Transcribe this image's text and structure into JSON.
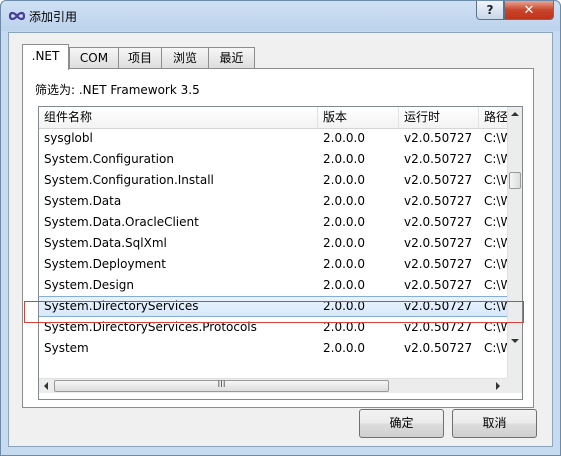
{
  "window": {
    "title": "添加引用",
    "help_glyph": "?",
    "close_glyph": "✕"
  },
  "tabs": [
    {
      "label": ".NET",
      "active": true
    },
    {
      "label": "COM",
      "active": false
    },
    {
      "label": "项目",
      "active": false
    },
    {
      "label": "浏览",
      "active": false
    },
    {
      "label": "最近",
      "active": false
    }
  ],
  "filter_text": "筛选为: .NET Framework 3.5",
  "table": {
    "columns": [
      "组件名称",
      "版本",
      "运行时",
      "路径"
    ],
    "rows": [
      {
        "name": "sysglobl",
        "version": "2.0.0.0",
        "runtime": "v2.0.50727",
        "path": "C:\\W"
      },
      {
        "name": "System.Configuration",
        "version": "2.0.0.0",
        "runtime": "v2.0.50727",
        "path": "C:\\W"
      },
      {
        "name": "System.Configuration.Install",
        "version": "2.0.0.0",
        "runtime": "v2.0.50727",
        "path": "C:\\W"
      },
      {
        "name": "System.Data",
        "version": "2.0.0.0",
        "runtime": "v2.0.50727",
        "path": "C:\\W"
      },
      {
        "name": "System.Data.OracleClient",
        "version": "2.0.0.0",
        "runtime": "v2.0.50727",
        "path": "C:\\W"
      },
      {
        "name": "System.Data.SqlXml",
        "version": "2.0.0.0",
        "runtime": "v2.0.50727",
        "path": "C:\\W"
      },
      {
        "name": "System.Deployment",
        "version": "2.0.0.0",
        "runtime": "v2.0.50727",
        "path": "C:\\W"
      },
      {
        "name": "System.Design",
        "version": "2.0.0.0",
        "runtime": "v2.0.50727",
        "path": "C:\\W"
      },
      {
        "name": "System.DirectoryServices",
        "version": "2.0.0.0",
        "runtime": "v2.0.50727",
        "path": "C:\\W",
        "selected": true
      },
      {
        "name": "System.DirectoryServices.Protocols",
        "version": "2.0.0.0",
        "runtime": "v2.0.50727",
        "path": "C:\\W"
      },
      {
        "name": "System",
        "version": "2.0.0.0",
        "runtime": "v2.0.50727",
        "path": "C:\\W"
      }
    ]
  },
  "buttons": {
    "ok": "确定",
    "cancel": "取消"
  },
  "hscroll_grip": "III"
}
